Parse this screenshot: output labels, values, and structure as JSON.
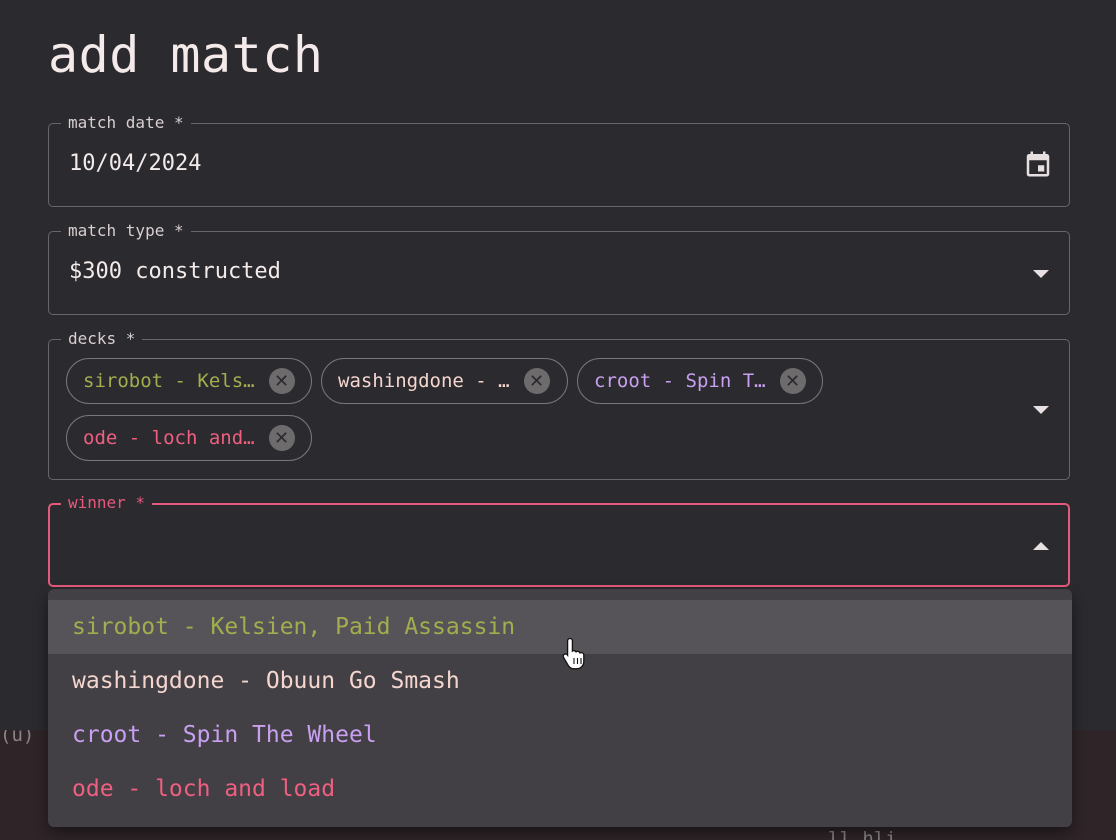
{
  "dialog": {
    "title": "add match"
  },
  "fields": {
    "match_date": {
      "label": "match date *",
      "value": "10/04/2024",
      "icon": "calendar-icon"
    },
    "match_type": {
      "label": "match type *",
      "value": "$300 constructed",
      "icon": "chevron-down-icon"
    },
    "decks": {
      "label": "decks *",
      "icon": "chevron-down-icon",
      "chips": [
        {
          "label": "sirobot - Kels…",
          "color": "#a3ad4e"
        },
        {
          "label": "washingdone - …",
          "color": "#f4d6cf"
        },
        {
          "label": "croot - Spin T…",
          "color": "#c9a0f0"
        },
        {
          "label": "ode - loch and…",
          "color": "#ee5f80"
        }
      ]
    },
    "winner": {
      "label": "winner *",
      "value": "",
      "icon": "chevron-up-icon",
      "accent": "#e35a7c"
    }
  },
  "winner_options": [
    {
      "label": "sirobot - Kelsien, Paid Assassin",
      "color": "#a3ad4e",
      "hovered": true
    },
    {
      "label": "washingdone - Obuun Go Smash",
      "color": "#f4d6cf",
      "hovered": false
    },
    {
      "label": "croot - Spin The Wheel",
      "color": "#c9a0f0",
      "hovered": false
    },
    {
      "label": "ode - loch and load",
      "color": "#ee5f80",
      "hovered": false
    }
  ],
  "background": {
    "left_text": "(u)",
    "bottom_text": "ll  hli"
  }
}
